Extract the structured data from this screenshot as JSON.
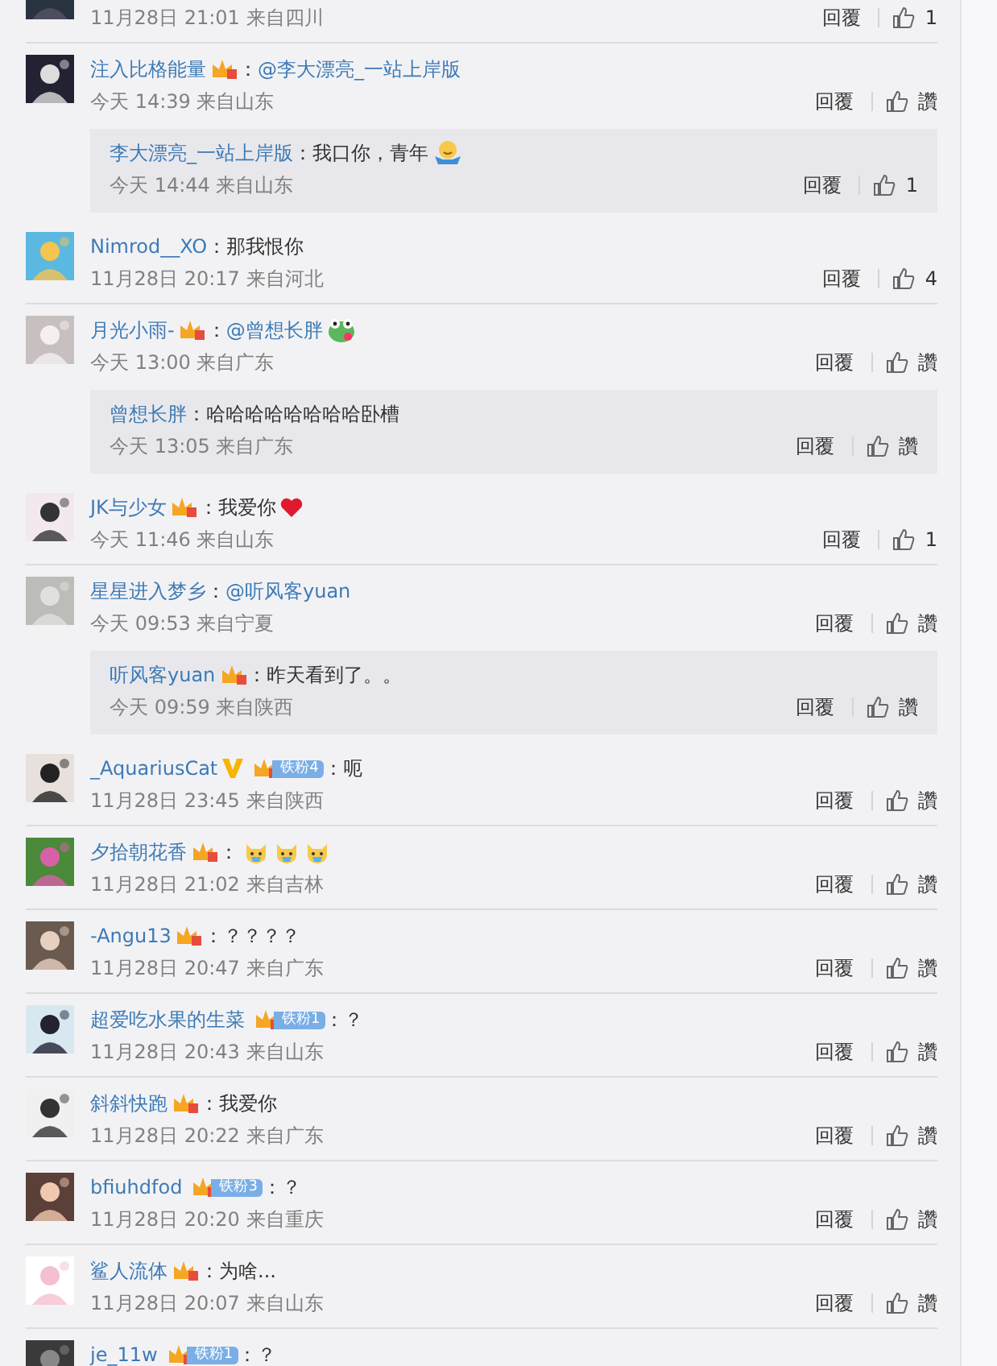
{
  "comments": [
    {
      "meta": "11月28日 21:01 来自四川",
      "reply": "回覆",
      "likes": "1"
    },
    {
      "name": "注入比格能量",
      "badges": [
        {
          "kind": "crown"
        }
      ],
      "content": [
        {
          "kind": "text",
          "text": "："
        },
        {
          "kind": "mention",
          "text": "@李大漂亮_一站上岸版"
        }
      ],
      "meta": "今天 14:39 来自山东",
      "reply": "回覆",
      "likes": "讚",
      "replies": [
        {
          "name": "李大漂亮_一站上岸版",
          "content": [
            {
              "kind": "text",
              "text": "：我口你，青年"
            },
            {
              "kind": "smiley"
            }
          ],
          "meta": "今天 14:44 来自山东",
          "reply": "回覆",
          "likes": "1"
        }
      ]
    },
    {
      "name": "Nimrod__XO",
      "content": [
        {
          "kind": "text",
          "text": "：那我恨你"
        }
      ],
      "meta": "11月28日 20:17 来自河北",
      "reply": "回覆",
      "likes": "4"
    },
    {
      "name": "月光小雨-",
      "badges": [
        {
          "kind": "crown"
        }
      ],
      "content": [
        {
          "kind": "text",
          "text": "："
        },
        {
          "kind": "mention",
          "text": "@曾想长胖"
        },
        {
          "kind": "frog"
        }
      ],
      "meta": "今天 13:00 来自广东",
      "reply": "回覆",
      "likes": "讚",
      "replies": [
        {
          "name": "曾想长胖",
          "content": [
            {
              "kind": "text",
              "text": "：哈哈哈哈哈哈哈哈卧槽"
            }
          ],
          "meta": "今天 13:05 来自广东",
          "reply": "回覆",
          "likes": "讚"
        }
      ]
    },
    {
      "name": "JK与少女",
      "badges": [
        {
          "kind": "crown"
        }
      ],
      "content": [
        {
          "kind": "text",
          "text": "：我爱你"
        },
        {
          "kind": "heart"
        }
      ],
      "meta": "今天 11:46 来自山东",
      "reply": "回覆",
      "likes": "1"
    },
    {
      "name": "星星进入梦乡",
      "content": [
        {
          "kind": "text",
          "text": "："
        },
        {
          "kind": "mention",
          "text": "@听风客yuan"
        }
      ],
      "meta": "今天 09:53 来自宁夏",
      "reply": "回覆",
      "likes": "讚",
      "replies": [
        {
          "name": "听风客yuan",
          "badges": [
            {
              "kind": "crown"
            }
          ],
          "content": [
            {
              "kind": "text",
              "text": "：昨天看到了。。"
            }
          ],
          "meta": "今天 09:59 来自陕西",
          "reply": "回覆",
          "likes": "讚"
        }
      ]
    },
    {
      "name": "_AquariusCat",
      "badges": [
        {
          "kind": "verified"
        },
        {
          "kind": "fan",
          "label": "铁粉4"
        }
      ],
      "content": [
        {
          "kind": "text",
          "text": "：呃"
        }
      ],
      "meta": "11月28日 23:45 来自陕西",
      "reply": "回覆",
      "likes": "讚"
    },
    {
      "name": "夕拾朝花香",
      "badges": [
        {
          "kind": "crown"
        }
      ],
      "content": [
        {
          "kind": "text",
          "text": "："
        },
        {
          "kind": "cat"
        },
        {
          "kind": "cat"
        },
        {
          "kind": "cat"
        }
      ],
      "meta": "11月28日 21:02 来自吉林",
      "reply": "回覆",
      "likes": "讚"
    },
    {
      "name": "-Angu13",
      "badges": [
        {
          "kind": "crown"
        }
      ],
      "content": [
        {
          "kind": "text",
          "text": "：？？？？"
        }
      ],
      "meta": "11月28日 20:47 来自广东",
      "reply": "回覆",
      "likes": "讚"
    },
    {
      "name": "超爱吃水果的生菜",
      "badges": [
        {
          "kind": "fan",
          "label": "铁粉1"
        }
      ],
      "content": [
        {
          "kind": "text",
          "text": "：？"
        }
      ],
      "meta": "11月28日 20:43 来自山东",
      "reply": "回覆",
      "likes": "讚"
    },
    {
      "name": "斜斜快跑",
      "badges": [
        {
          "kind": "crown"
        }
      ],
      "content": [
        {
          "kind": "text",
          "text": "：我爱你"
        }
      ],
      "meta": "11月28日 20:22 来自广东",
      "reply": "回覆",
      "likes": "讚"
    },
    {
      "name": "bfiuhdfod",
      "badges": [
        {
          "kind": "fan",
          "label": "铁粉3"
        }
      ],
      "content": [
        {
          "kind": "text",
          "text": "：？"
        }
      ],
      "meta": "11月28日 20:20 来自重庆",
      "reply": "回覆",
      "likes": "讚"
    },
    {
      "name": "鲨人流体",
      "badges": [
        {
          "kind": "crown"
        }
      ],
      "content": [
        {
          "kind": "text",
          "text": "：为啥..."
        }
      ],
      "meta": "11月28日 20:07 来自山东",
      "reply": "回覆",
      "likes": "讚"
    },
    {
      "name": "je_11w",
      "badges": [
        {
          "kind": "fan",
          "label": "铁粉1"
        }
      ],
      "content": [
        {
          "kind": "text",
          "text": "：？"
        }
      ]
    }
  ]
}
